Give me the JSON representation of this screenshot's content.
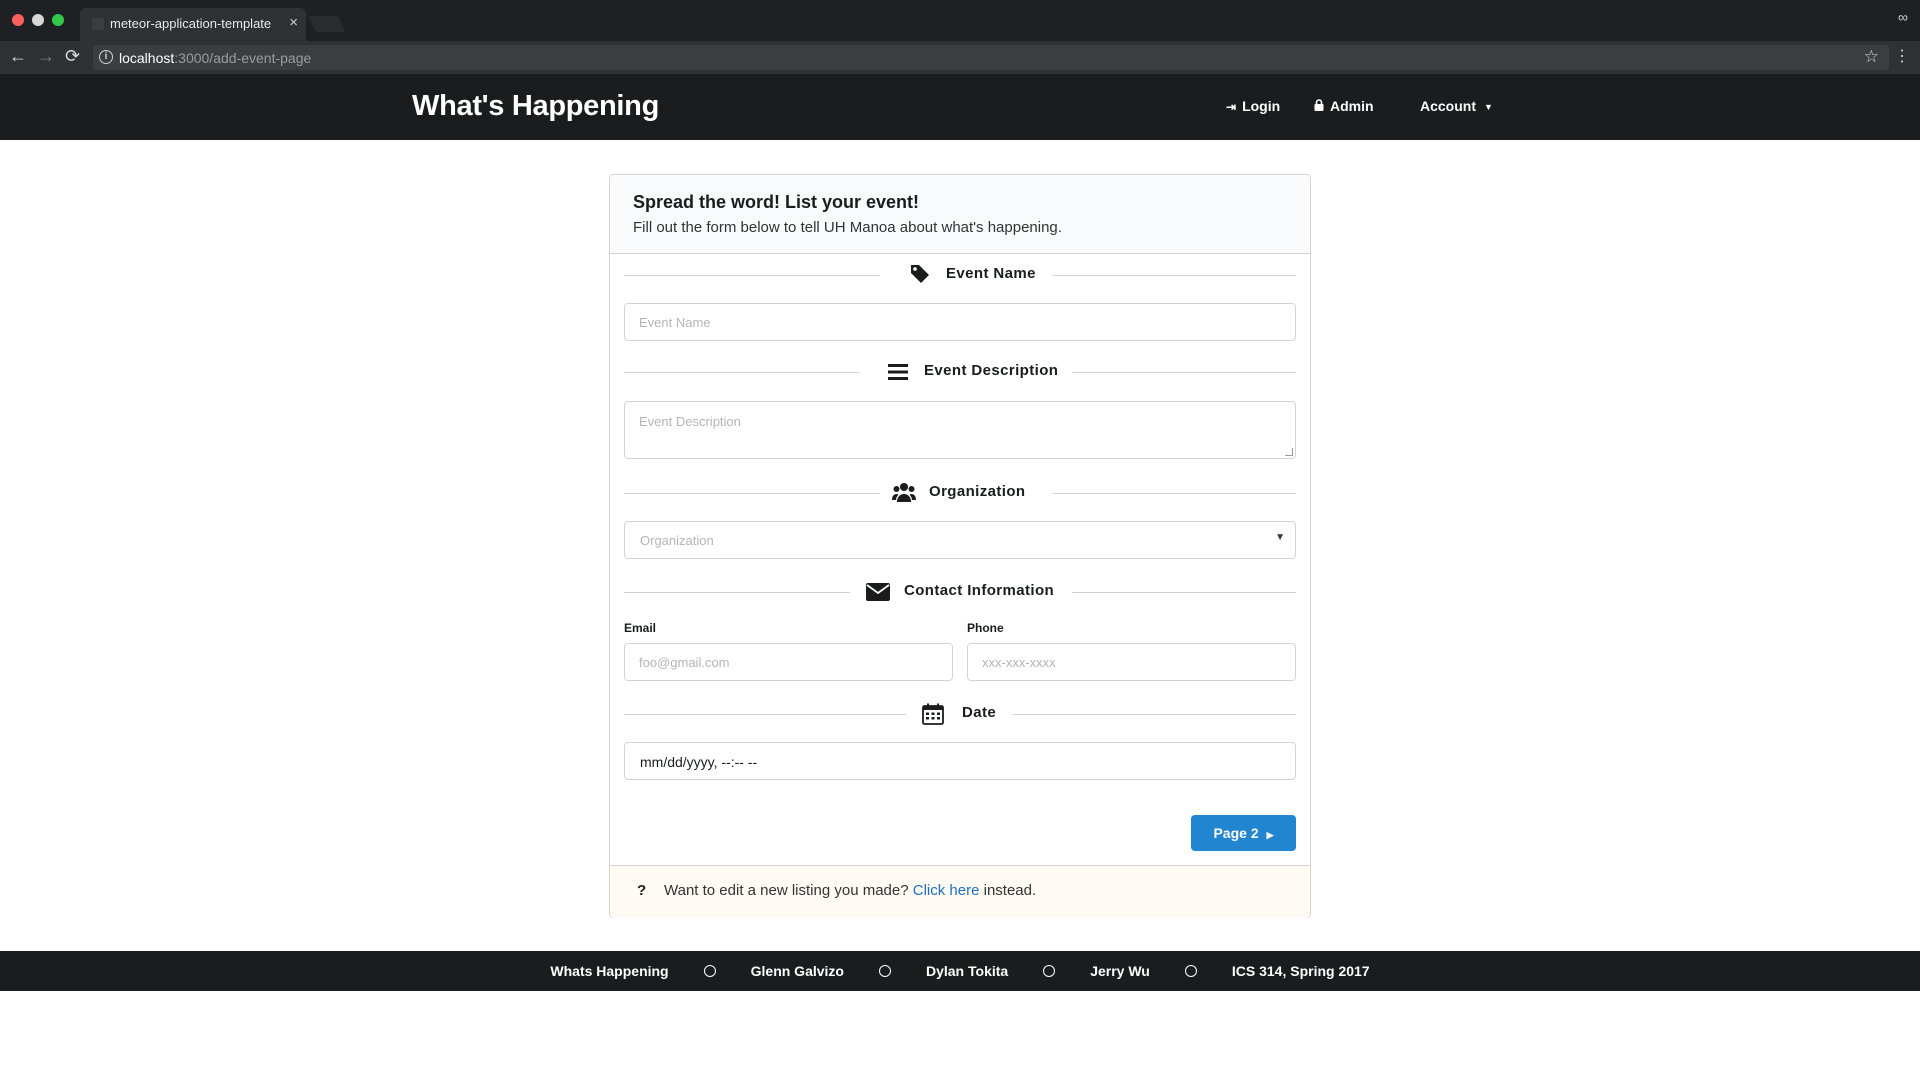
{
  "browser": {
    "tab_title": "meteor-application-template",
    "tab_close": "×",
    "url_host": "localhost",
    "url_rest": ":3000/add-event-page",
    "back": "←",
    "forward": "→",
    "reload": "⟳",
    "info": "i",
    "star": "☆",
    "menu": "⋮",
    "incognito": "∞"
  },
  "navbar": {
    "brand": "What's Happening",
    "login": "Login",
    "admin": "Admin",
    "account": "Account",
    "login_icon": "⇥",
    "admin_icon": "🔒",
    "caret": "▼"
  },
  "form": {
    "title": "Spread the word! List your event!",
    "subtitle": "Fill out the form below to tell UH Manoa about what's happening.",
    "sections": {
      "event_name": {
        "label": "Event Name",
        "icon": "tag-icon",
        "glyph": "🏷",
        "placeholder": "Event Name"
      },
      "event_description": {
        "label": "Event Description",
        "icon": "align-justify-icon",
        "glyph": "☰",
        "placeholder": "Event Description"
      },
      "organization": {
        "label": "Organization",
        "icon": "users-icon",
        "glyph": "👥",
        "placeholder": "Organization"
      },
      "contact": {
        "label": "Contact Information",
        "icon": "envelope-icon",
        "glyph": "✉"
      },
      "date": {
        "label": "Date",
        "icon": "calendar-icon",
        "glyph": "📅",
        "value": "mm/dd/yyyy, --:-- --"
      }
    },
    "email": {
      "label": "Email",
      "placeholder": "foo@gmail.com"
    },
    "phone": {
      "label": "Phone",
      "placeholder": "xxx-xxx-xxxx"
    },
    "select_caret": "▼",
    "next_button": "Page 2",
    "next_caret": "▶",
    "footer": {
      "icon": "?",
      "text_before": "Want to edit a new listing you made?",
      "link": "Click here",
      "text_after": "instead."
    }
  },
  "footer": {
    "items": [
      "Whats Happening",
      "Glenn Galvizo",
      "Dylan Tokita",
      "Jerry Wu",
      "ICS 314, Spring 2017"
    ]
  },
  "colors": {
    "primary": "#2185d0",
    "link": "#1e70bf",
    "dark": "#1b1c1d"
  }
}
